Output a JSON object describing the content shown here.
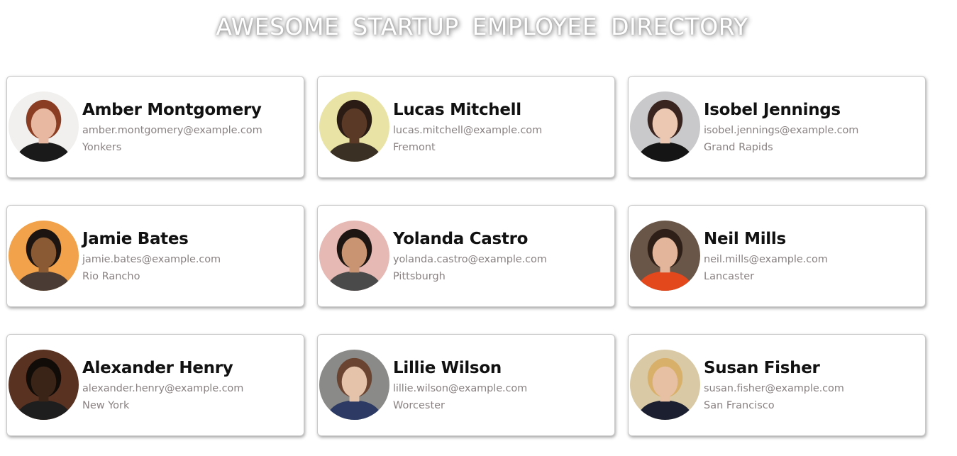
{
  "header": {
    "title": "AWESOME STARTUP EMPLOYEE DIRECTORY"
  },
  "employees": [
    {
      "name": "Amber Montgomery",
      "email": "amber.montgomery@example.com",
      "city": "Yonkers",
      "bg": "#f2f0ee",
      "skin": "#e8b9a0",
      "hair": "#8a3d22",
      "shirt": "#1a1a1a"
    },
    {
      "name": "Lucas Mitchell",
      "email": "lucas.mitchell@example.com",
      "city": "Fremont",
      "bg": "#e9e4a6",
      "skin": "#5a3a26",
      "hair": "#2a1c14",
      "shirt": "#3a3024"
    },
    {
      "name": "Isobel Jennings",
      "email": "isobel.jennings@example.com",
      "city": "Grand Rapids",
      "bg": "#c9c9cb",
      "skin": "#ecc8b2",
      "hair": "#3a2420",
      "shirt": "#151515"
    },
    {
      "name": "Jamie Bates",
      "email": "jamie.bates@example.com",
      "city": "Rio Rancho",
      "bg": "#f1a24a",
      "skin": "#8a5a34",
      "hair": "#1c1410",
      "shirt": "#4a3c34"
    },
    {
      "name": "Yolanda Castro",
      "email": "yolanda.castro@example.com",
      "city": "Pittsburgh",
      "bg": "#e7b9b4",
      "skin": "#c99472",
      "hair": "#1c1512",
      "shirt": "#4a4a4a"
    },
    {
      "name": "Neil Mills",
      "email": "neil.mills@example.com",
      "city": "Lancaster",
      "bg": "#6a5648",
      "skin": "#e3b59a",
      "hair": "#2e2018",
      "shirt": "#e2481c"
    },
    {
      "name": "Alexander Henry",
      "email": "alexander.henry@example.com",
      "city": "New York",
      "bg": "#5a3222",
      "skin": "#3a2418",
      "hair": "#120c08",
      "shirt": "#1e1e1e"
    },
    {
      "name": "Lillie Wilson",
      "email": "lillie.wilson@example.com",
      "city": "Worcester",
      "bg": "#8a8a88",
      "skin": "#e5c2aa",
      "hair": "#6a4430",
      "shirt": "#2c3a64"
    },
    {
      "name": "Susan Fisher",
      "email": "susan.fisher@example.com",
      "city": "San Francisco",
      "bg": "#d9c9a4",
      "skin": "#e7c0a4",
      "hair": "#d9b06a",
      "shirt": "#1b1f30"
    }
  ]
}
